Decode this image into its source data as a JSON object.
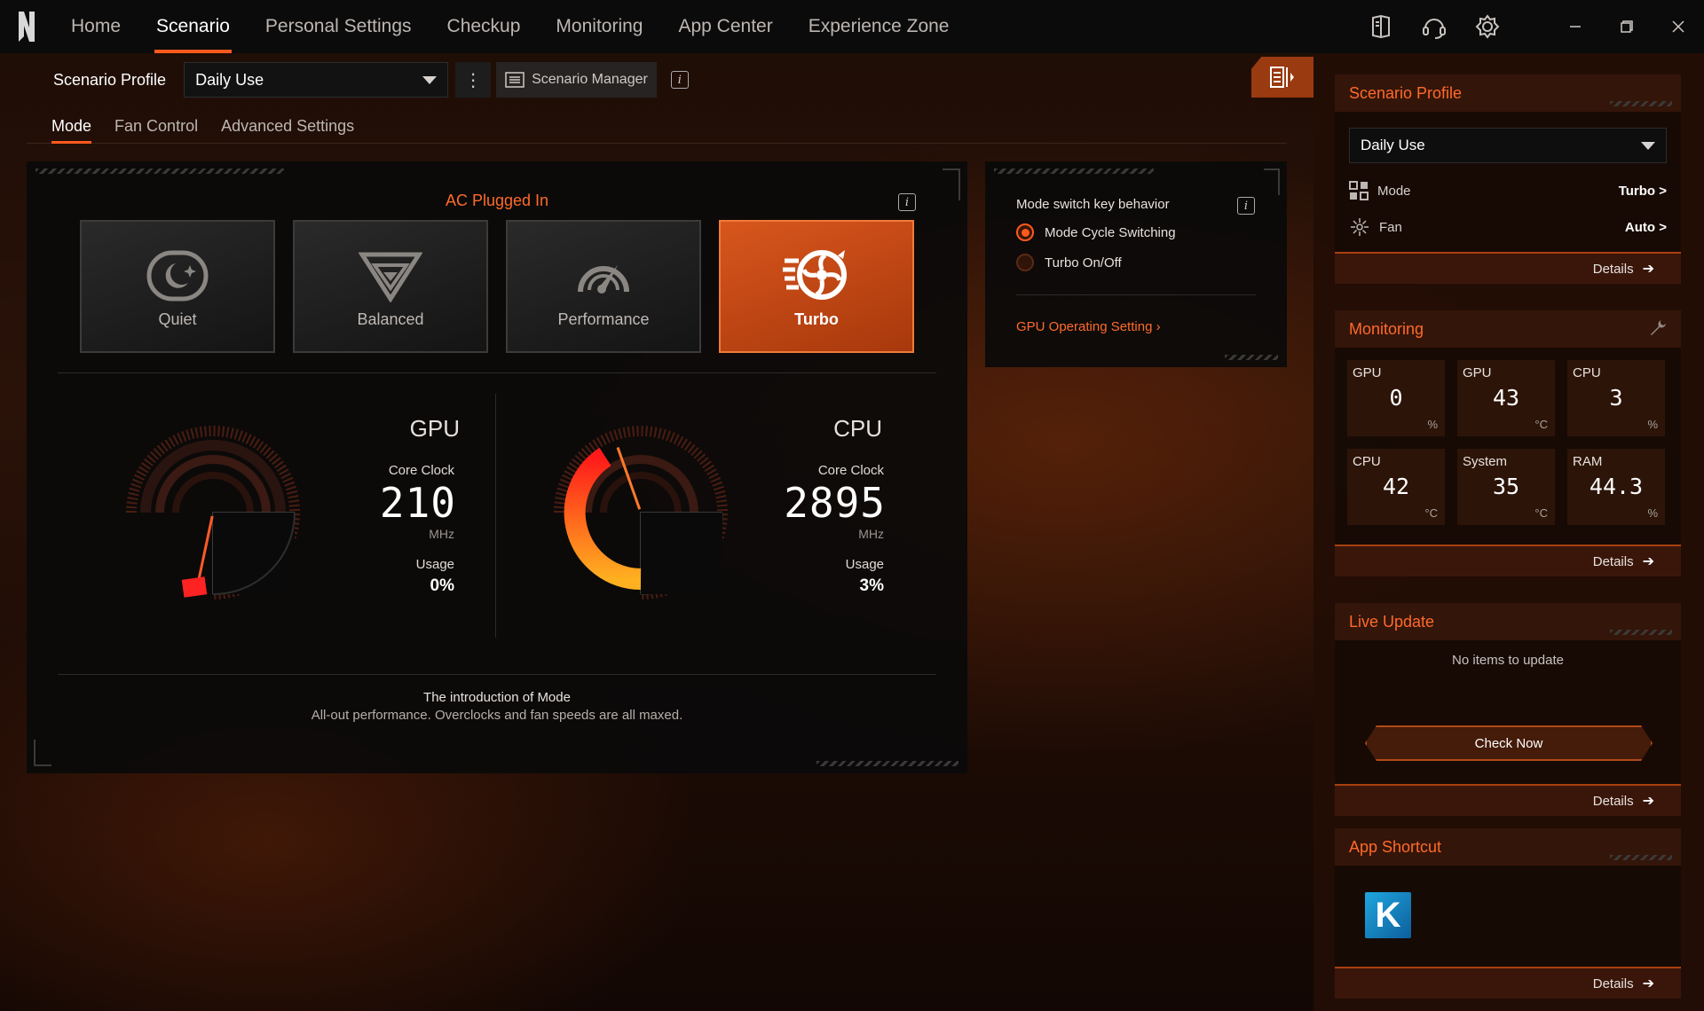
{
  "nav": {
    "items": [
      "Home",
      "Scenario",
      "Personal Settings",
      "Checkup",
      "Monitoring",
      "App Center",
      "Experience Zone"
    ],
    "active_index": 1
  },
  "profile_bar": {
    "label": "Scenario Profile",
    "selected": "Daily Use",
    "manager_label": "Scenario Manager"
  },
  "subtabs": [
    "Mode",
    "Fan Control",
    "Advanced Settings"
  ],
  "mode_panel": {
    "power_state": "AC Plugged In",
    "modes": [
      {
        "label": "Quiet",
        "icon": "moon-icon",
        "active": false
      },
      {
        "label": "Balanced",
        "icon": "balanced-icon",
        "active": false
      },
      {
        "label": "Performance",
        "icon": "speedometer-icon",
        "active": false
      },
      {
        "label": "Turbo",
        "icon": "turbo-fan-icon",
        "active": true
      }
    ],
    "gpu": {
      "title": "GPU",
      "clock_label": "Core Clock",
      "clock_value": "210",
      "clock_unit": "MHz",
      "usage_label": "Usage",
      "usage_value": "0%",
      "usage_fraction": 0.0
    },
    "cpu": {
      "title": "CPU",
      "clock_label": "Core Clock",
      "clock_value": "2895",
      "clock_unit": "MHz",
      "usage_label": "Usage",
      "usage_value": "3%",
      "usage_fraction": 0.03
    },
    "intro_title": "The introduction of Mode",
    "intro_desc": "All-out performance. Overclocks and fan speeds are all maxed."
  },
  "key_panel": {
    "title": "Mode switch key behavior",
    "options": [
      "Mode Cycle Switching",
      "Turbo On/Off"
    ],
    "selected_index": 0,
    "gpu_link": "GPU Operating Setting"
  },
  "sidebar": {
    "scenario_profile": {
      "title": "Scenario Profile",
      "selected": "Daily Use",
      "mode_label": "Mode",
      "mode_value": "Turbo",
      "fan_label": "Fan",
      "fan_value": "Auto",
      "details": "Details"
    },
    "monitoring": {
      "title": "Monitoring",
      "tiles": [
        {
          "label": "GPU",
          "value": "0",
          "unit": "%"
        },
        {
          "label": "GPU",
          "value": "43",
          "unit": "°C"
        },
        {
          "label": "CPU",
          "value": "3",
          "unit": "%"
        },
        {
          "label": "CPU",
          "value": "42",
          "unit": "°C"
        },
        {
          "label": "System",
          "value": "35",
          "unit": "°C"
        },
        {
          "label": "RAM",
          "value": "44.3",
          "unit": "%"
        }
      ],
      "details": "Details"
    },
    "live_update": {
      "title": "Live Update",
      "empty_text": "No items to update",
      "button": "Check Now",
      "details": "Details"
    },
    "app_shortcut": {
      "title": "App Shortcut",
      "app_letter": "K",
      "details": "Details"
    }
  },
  "colors": {
    "accent": "#ff5a1e",
    "accent_text": "#ff6a2a",
    "panel_bg": "#0a0a0a",
    "sidebar_bg": "#220e05"
  }
}
